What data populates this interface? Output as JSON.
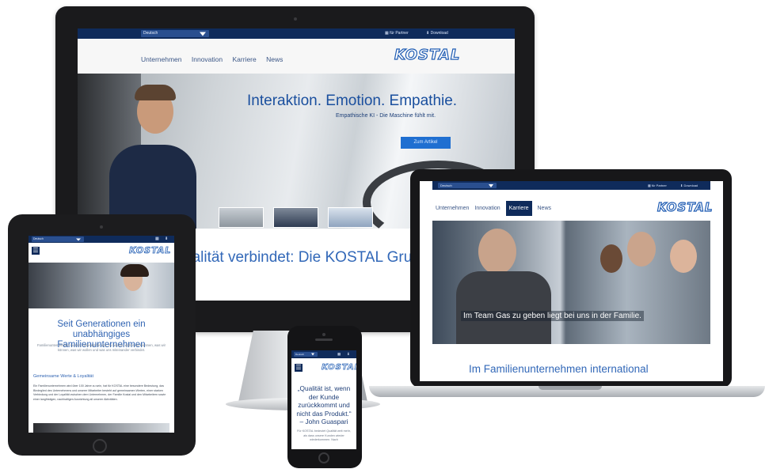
{
  "colors": {
    "navy": "#0f2b5b",
    "brand_blue": "#1f5cb3",
    "text_blue": "#1d3f78",
    "cta_blue": "#1f6fd1"
  },
  "site": {
    "lang": "Deutsch",
    "partner_label": "für Partner",
    "download_label": "Download",
    "logo": "KOSTAL",
    "nav": [
      "Unternehmen",
      "Innovation",
      "Karriere",
      "News"
    ]
  },
  "desktop": {
    "hero_title": "Interaktion. Emotion. Empathie.",
    "hero_subtitle": "Empathische KI - Die Maschine fühlt mit.",
    "hero_button": "Zum Artikel",
    "tagline": "ualität verbindet: Die KOSTAL Grupp"
  },
  "laptop": {
    "active_nav": "Karriere",
    "banner_caption": "Im Team Gas zu geben liegt bei uns in der Familie.",
    "heading": "Im Familienunternehmen international"
  },
  "tablet": {
    "heading": "Seit Generationen ein unabhängiges Familienunternehmen",
    "intro": "Familienunternehmen zu sein, bedeutet für uns, zu wissen, woher wir kommen, was wir können, was wir wollen und was uns miteinander verbindet.",
    "subheading": "Gemeinsame Werte & Loyalität",
    "body": "Ein Familienunternehmen wird über 100 Jahre zu sein, hat für KOSTAL eine besondere Bedeutung, das Bindeglied des Unternehmens und unserer Mitarbeiter besteht auf gemeinsamen Werten, einer starken Verbindung und der Loyalität zwischen dem Unternehmen, der Familie Kostal und den Mitarbeitern sowie einer langfristigen, nachhaltigen Ausrichtung all unserer Aktivitäten."
  },
  "phone": {
    "quote": "„Qualität ist, wenn der Kunde zurückkommt und nicht das Produkt.“ – John Guaspari",
    "body": "Für KOSTAL bedeutet Qualität weit mehr, als dass unsere Kunden wieder wiederkommen. Nach"
  },
  "icons": [
    "partner-icon",
    "download-icon",
    "menu-icon",
    "caret-down-icon"
  ]
}
